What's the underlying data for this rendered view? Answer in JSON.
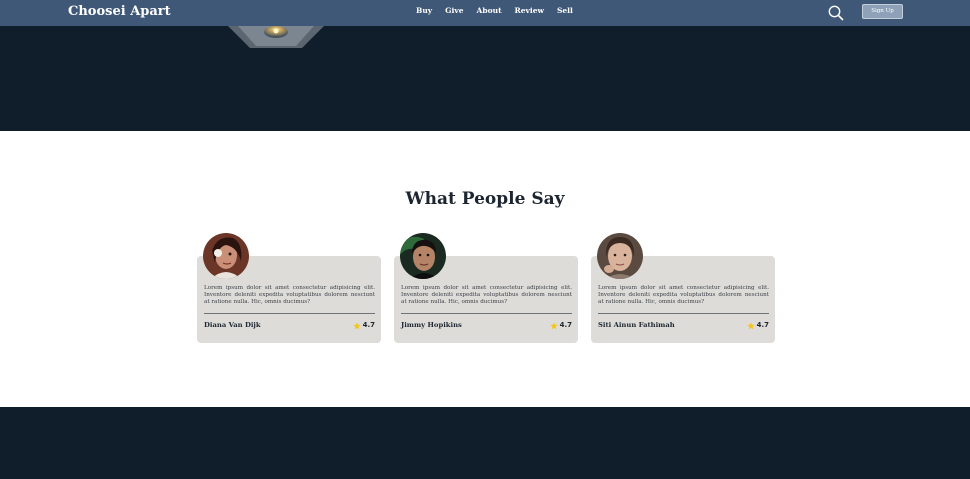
{
  "navbar": {
    "brand": "Choosei Apart",
    "links": [
      "Buy",
      "Give",
      "About",
      "Review",
      "Sell"
    ],
    "search_icon": "search-icon",
    "signup_label": "Sign Up"
  },
  "testimonials": {
    "title": "What People Say",
    "cards": [
      {
        "text": "Lorem ipsum dolor sit amet consectetur adipisicing elit. Inventore deleniti expedita voluptatibus dolorem nesciunt at ratione nulla. Hic, omnis ducimus?",
        "name": "Diana Van Dijk",
        "rating": "4.7",
        "rating_icon": "star-icon"
      },
      {
        "text": "Lorem ipsum dolor sit amet consectetur adipisicing elit. Inventore deleniti expedita voluptatibus dolorem nesciunt at ratione nulla. Hic, omnis ducimus?",
        "name": "Jimmy Hopikins",
        "rating": "4.7",
        "rating_icon": "star-icon"
      },
      {
        "text": "Lorem ipsum dolor sit amet consectetur adipisicing elit. Inventore deleniti expedita voluptatibus dolorem nesciunt at ratione nulla. Hic, omnis ducimus?",
        "name": "Siti Ainun Fathimah",
        "rating": "4.7",
        "rating_icon": "star-icon"
      }
    ]
  },
  "colors": {
    "navbar": "#3f5877",
    "dark_section": "#101e2b",
    "card": "#dedcd8",
    "star": "#f5c518"
  }
}
